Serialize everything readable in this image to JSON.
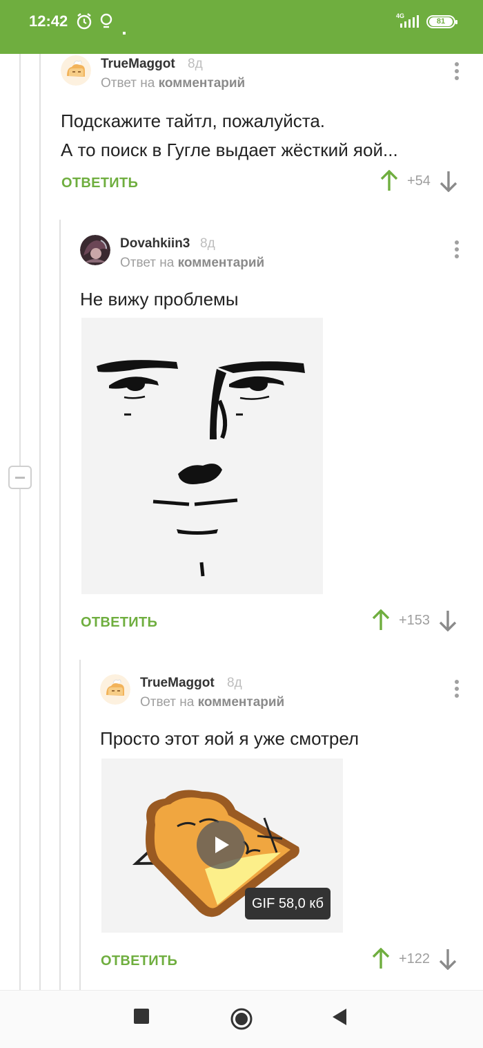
{
  "status_bar": {
    "time": "12:42",
    "network": "4G",
    "battery": "81",
    "color": "#6fae3f"
  },
  "colors": {
    "accent": "#6fae3f",
    "thread_line": "#e0e0e0",
    "muted": "#9e9e9e"
  },
  "comments": [
    {
      "author": "TrueMaggot",
      "time": "8д",
      "reply_prefix": "Ответ на",
      "reply_target": "комментарий",
      "lines": [
        "Подскажите тайтл, пожалуйста.",
        "А то поиск в Гугле выдает жёсткий яой..."
      ],
      "reply_label": "ОТВЕТИТЬ",
      "score": "+54"
    },
    {
      "author": "Dovahkiin3",
      "time": "8д",
      "reply_prefix": "Ответ на",
      "reply_target": "комментарий",
      "lines": [
        "Не вижу проблемы"
      ],
      "image": "meme-face-drawing",
      "reply_label": "ОТВЕТИТЬ",
      "score": "+153"
    },
    {
      "author": "TrueMaggot",
      "time": "8д",
      "reply_prefix": "Ответ на",
      "reply_target": "комментарий",
      "lines": [
        "Просто этот яой я уже смотрел"
      ],
      "gif": {
        "badge": "GIF 58,0 кб",
        "icon": "play-icon"
      },
      "reply_label": "ОТВЕТИТЬ",
      "score": "+122"
    }
  ],
  "nav_bar": {
    "recents": "square-icon",
    "home": "circle-icon",
    "back": "triangle-back-icon"
  }
}
